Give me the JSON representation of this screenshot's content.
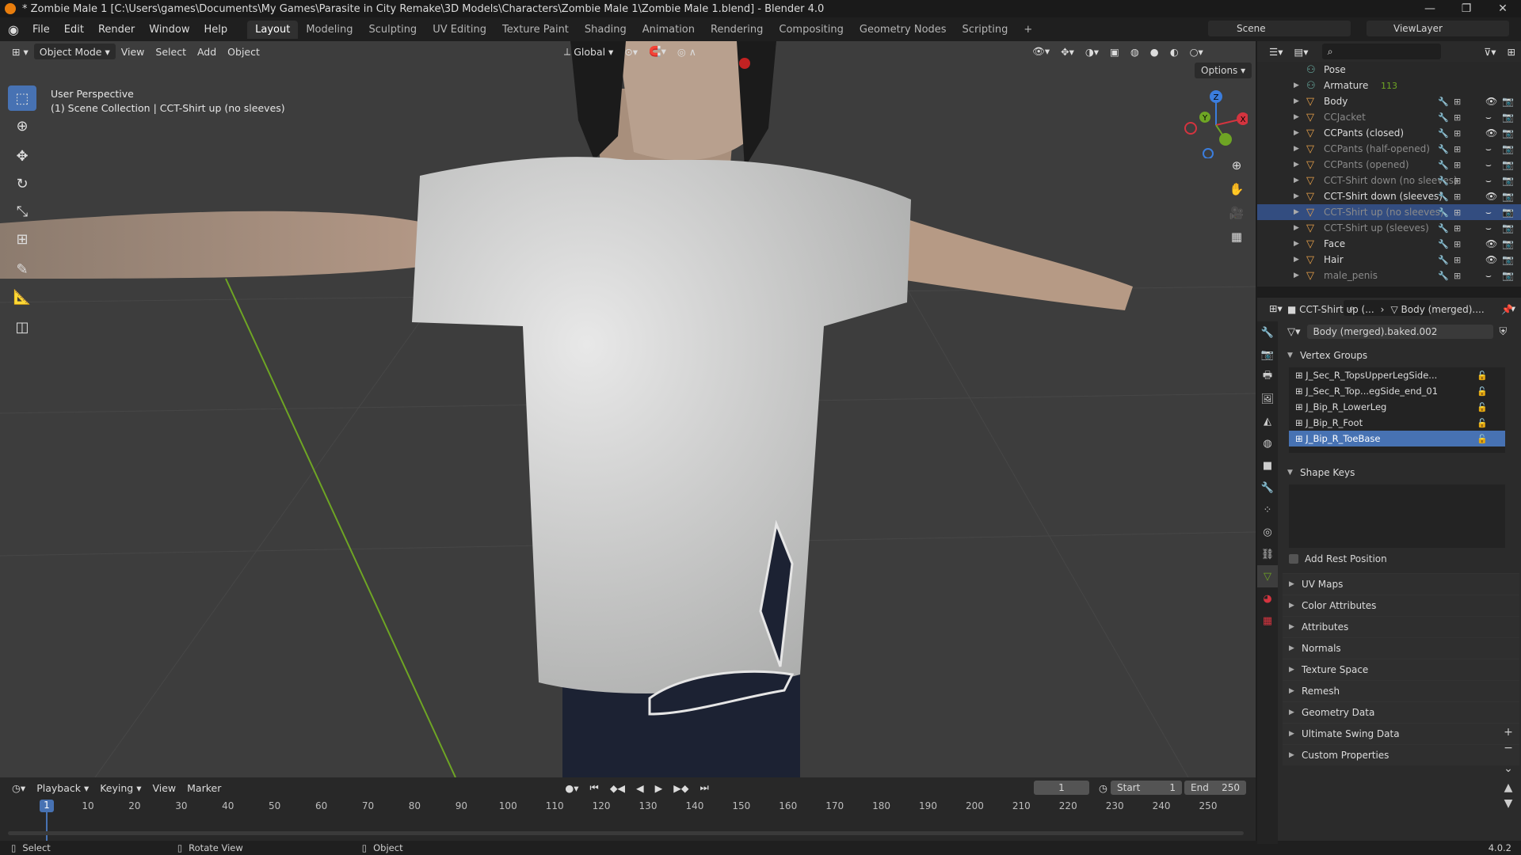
{
  "window": {
    "title": "* Zombie Male 1 [C:\\Users\\games\\Documents\\My Games\\Parasite in City Remake\\3D Models\\Characters\\Zombie Male 1\\Zombie Male 1.blend] - Blender 4.0",
    "controls": [
      "—",
      "❐",
      "✕"
    ]
  },
  "menus": [
    "File",
    "Edit",
    "Render",
    "Window",
    "Help"
  ],
  "workspaces": [
    "Layout",
    "Modeling",
    "Sculpting",
    "UV Editing",
    "Texture Paint",
    "Shading",
    "Animation",
    "Rendering",
    "Compositing",
    "Geometry Nodes",
    "Scripting"
  ],
  "add_workspace": "+",
  "scene": "Scene",
  "view_layer": "ViewLayer",
  "viewport": {
    "mode": "Object Mode",
    "header_menus": [
      "View",
      "Select",
      "Add",
      "Object"
    ],
    "orientation": "Global",
    "options": "Options",
    "info_line1": "User Perspective",
    "info_line2": "(1) Scene Collection | CCT-Shirt up (no sleeves)",
    "gizmo_axes": {
      "z": "Z",
      "y": "Y",
      "x": "X"
    },
    "colors": {
      "bg": "#3d3d3d",
      "shirt": "#cfcfcf",
      "skin": "#b99b84",
      "hair": "#1b1b1b",
      "pants": "#1c2233",
      "x_axis": "#d4343f",
      "y_axis": "#6ea524",
      "z_axis": "#3b7ddd"
    }
  },
  "timeline": {
    "menus": [
      "Playback",
      "Keying",
      "View",
      "Marker"
    ],
    "current_frame": "1",
    "start_label": "Start",
    "start": "1",
    "end_label": "End",
    "end": "250",
    "ticks": [
      "1",
      "10",
      "20",
      "30",
      "40",
      "50",
      "60",
      "70",
      "80",
      "90",
      "100",
      "110",
      "120",
      "130",
      "140",
      "150",
      "160",
      "170",
      "180",
      "190",
      "200",
      "210",
      "220",
      "230",
      "240",
      "250"
    ]
  },
  "status": {
    "select": "Select",
    "rotate": "Rotate View",
    "object": "Object",
    "version": "4.0.2"
  },
  "outliner": {
    "rows": [
      {
        "label": "Pose",
        "dim": false,
        "sel": false,
        "eye": false
      },
      {
        "label": "Armature",
        "dim": false,
        "sel": false,
        "eye": false,
        "count": "113"
      },
      {
        "label": "Body",
        "dim": false,
        "sel": false,
        "eye": true
      },
      {
        "label": "CCJacket",
        "dim": true,
        "sel": false,
        "eye": false
      },
      {
        "label": "CCPants (closed)",
        "dim": false,
        "sel": false,
        "eye": true
      },
      {
        "label": "CCPants (half-opened)",
        "dim": true,
        "sel": false,
        "eye": false
      },
      {
        "label": "CCPants (opened)",
        "dim": true,
        "sel": false,
        "eye": false
      },
      {
        "label": "CCT-Shirt down (no sleeves)",
        "dim": true,
        "sel": false,
        "eye": false
      },
      {
        "label": "CCT-Shirt down (sleeves)",
        "dim": false,
        "sel": false,
        "eye": true
      },
      {
        "label": "CCT-Shirt up (no sleeves)",
        "dim": true,
        "sel": true,
        "eye": false
      },
      {
        "label": "CCT-Shirt up (sleeves)",
        "dim": true,
        "sel": false,
        "eye": false
      },
      {
        "label": "Face",
        "dim": false,
        "sel": false,
        "eye": true
      },
      {
        "label": "Hair",
        "dim": false,
        "sel": false,
        "eye": true
      },
      {
        "label": "male_penis",
        "dim": true,
        "sel": false,
        "eye": false
      }
    ]
  },
  "properties": {
    "breadcrumb_object": "CCT-Shirt up (...",
    "breadcrumb_data": "Body (merged)....",
    "mesh_name": "Body (merged).baked.002",
    "vertex_groups_title": "Vertex Groups",
    "vertex_groups": [
      {
        "name": "J_Sec_R_TopsUpperLegSide...",
        "sel": false
      },
      {
        "name": "J_Sec_R_Top...egSide_end_01",
        "sel": false
      },
      {
        "name": "J_Bip_R_LowerLeg",
        "sel": false
      },
      {
        "name": "J_Bip_R_Foot",
        "sel": false
      },
      {
        "name": "J_Bip_R_ToeBase",
        "sel": true
      }
    ],
    "shape_keys_title": "Shape Keys",
    "add_rest_position": "Add Rest Position",
    "collapsed_panels": [
      "UV Maps",
      "Color Attributes",
      "Attributes",
      "Normals",
      "Texture Space",
      "Remesh",
      "Geometry Data",
      "Ultimate Swing Data",
      "Custom Properties"
    ]
  }
}
